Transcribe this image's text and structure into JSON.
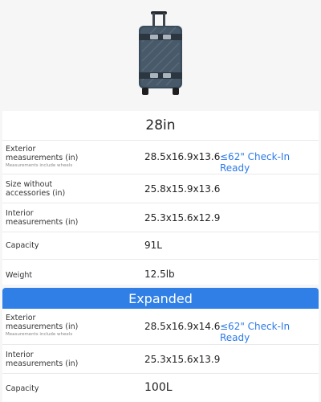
{
  "product_image": {
    "icon": "suitcase-image",
    "colors": {
      "shell": "#3a4b5c",
      "shell_light": "#5d7080",
      "handle": "#222a33"
    }
  },
  "standard": {
    "size": "28in",
    "rows": [
      {
        "label_line1": "Exterior",
        "label_line2": "measurements (in)",
        "note": "Measurements include wheels",
        "value": "28.5x16.9x13.6",
        "tag": "≤62\" Check-In Ready"
      },
      {
        "label_line1": "Size without",
        "label_line2": "accessories (in)",
        "value": "25.8x15.9x13.6"
      },
      {
        "label_line1": "Interior",
        "label_line2": "measurements (in)",
        "value": "25.3x15.6x12.9"
      },
      {
        "label_line1": "Capacity",
        "value": "91L"
      },
      {
        "label_line1": "Weight",
        "value": "12.5lb"
      }
    ]
  },
  "expanded": {
    "title": "Expanded",
    "accent": "#2f7fe6",
    "rows": [
      {
        "label_line1": "Exterior",
        "label_line2": "measurements (in)",
        "note": "Measurements include wheels",
        "value": "28.5x16.9x14.6",
        "tag": "≤62\" Check-In Ready"
      },
      {
        "label_line1": "Interior",
        "label_line2": "measurements (in)",
        "value": "25.3x15.6x13.9"
      },
      {
        "label_line1": "Capacity",
        "value": "100L"
      }
    ]
  }
}
